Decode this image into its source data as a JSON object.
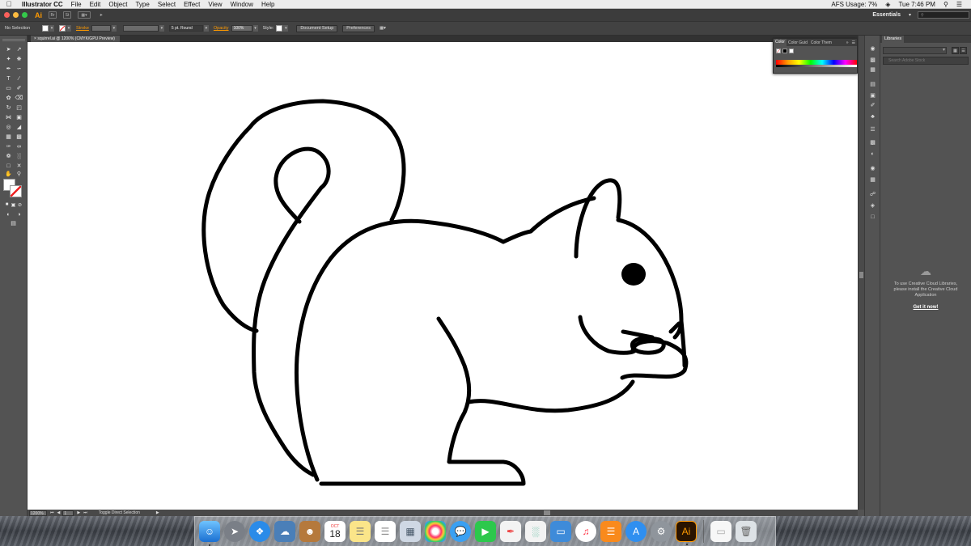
{
  "menubar": {
    "app_name": "Illustrator CC",
    "menus": [
      "File",
      "Edit",
      "Object",
      "Type",
      "Select",
      "Effect",
      "View",
      "Window",
      "Help"
    ],
    "afs_usage": "AFS Usage: 7%",
    "clock": "Tue 7:46 PM"
  },
  "appbar": {
    "logo": "Ai",
    "workspace": "Essentials"
  },
  "control": {
    "selection": "No Selection",
    "stroke_label": "Stroke",
    "brush": "5 pt. Round",
    "opacity_label": "Opacity",
    "opacity_value": "100%",
    "style_label": "Style:",
    "doc_setup": "Document Setup",
    "preferences": "Preferences"
  },
  "document": {
    "tab_title": "squirrel.ai @ 1200% (CMYK/GPU Preview)"
  },
  "status": {
    "zoom": "1200%",
    "page": "1",
    "state": "Toggle Direct Selection"
  },
  "color_panel": {
    "tabs": [
      "Color",
      "Color Guid",
      "Color Them"
    ]
  },
  "libraries": {
    "title": "Libraries",
    "search_placeholder": "Search Adobe Stock",
    "message": "To use Creative Cloud Libraries, please install the Creative Cloud Application",
    "link": "Get it now!"
  },
  "dock": {
    "calendar_month": "OCT",
    "calendar_day": "18",
    "illustrator_label": "Ai"
  },
  "colors": {
    "accent": "#ff9a00",
    "stroke_none": "#e22222"
  }
}
